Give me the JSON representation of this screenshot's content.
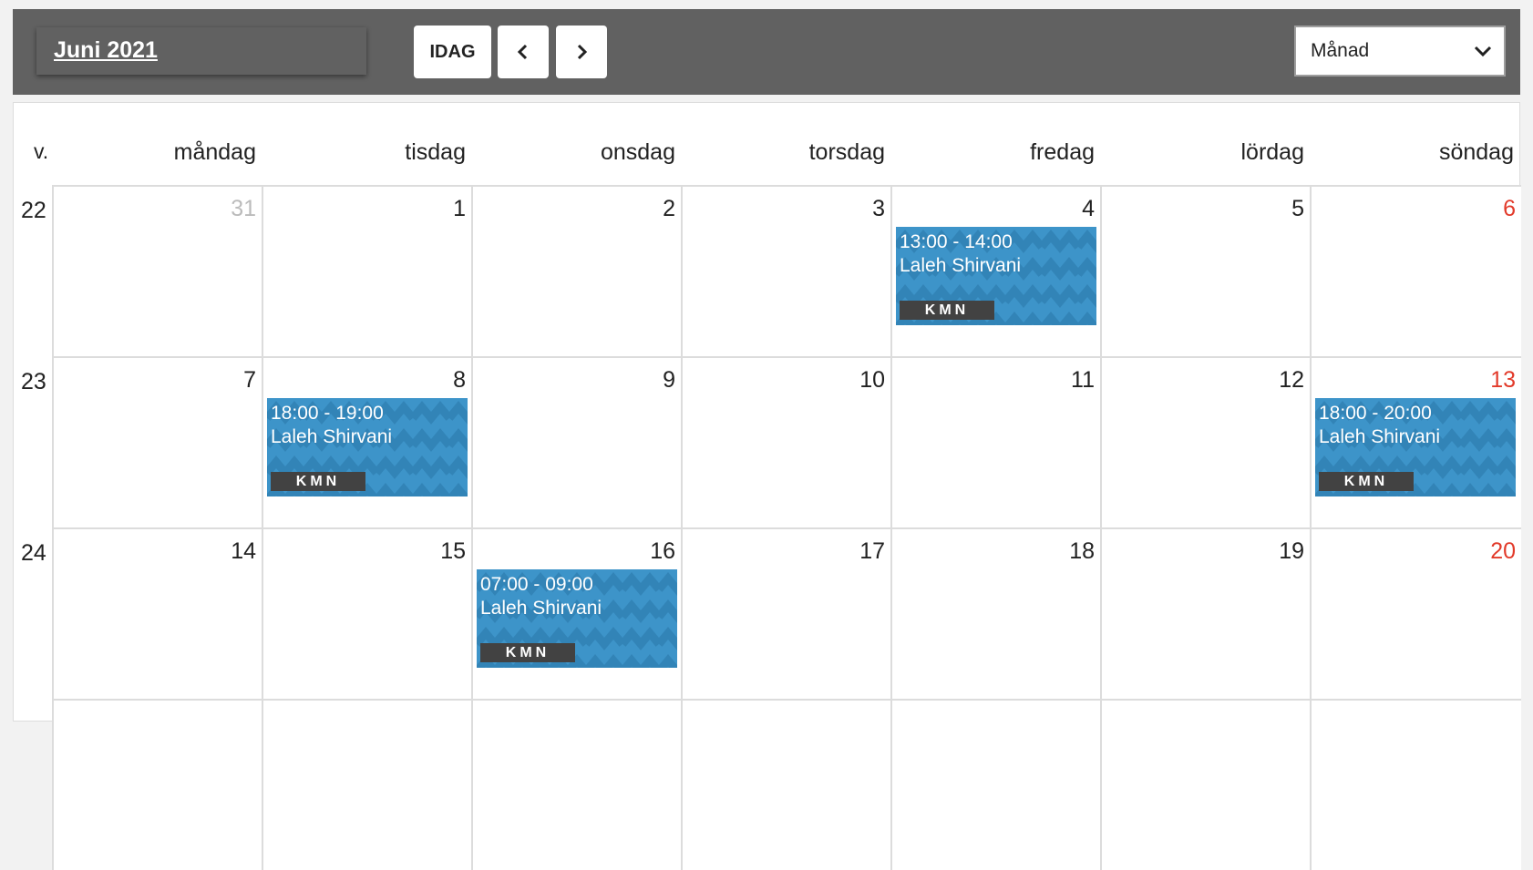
{
  "header": {
    "title": "Juni 2021",
    "today_label": "IDAG",
    "view_select": "Månad"
  },
  "calendar": {
    "week_label": "v.",
    "weekdays": [
      "måndag",
      "tisdag",
      "onsdag",
      "torsdag",
      "fredag",
      "lördag",
      "söndag"
    ],
    "weeks": [
      {
        "number": "22",
        "days": [
          {
            "day": "31",
            "other_month": true
          },
          {
            "day": "1"
          },
          {
            "day": "2"
          },
          {
            "day": "3"
          },
          {
            "day": "4",
            "event": {
              "time": "13:00 - 14:00",
              "name": "Laleh Shirvani",
              "tag": "KMN"
            }
          },
          {
            "day": "5"
          },
          {
            "day": "6",
            "sunday": true
          }
        ]
      },
      {
        "number": "23",
        "days": [
          {
            "day": "7"
          },
          {
            "day": "8",
            "event": {
              "time": "18:00 - 19:00",
              "name": "Laleh Shirvani",
              "tag": "KMN"
            }
          },
          {
            "day": "9"
          },
          {
            "day": "10"
          },
          {
            "day": "11"
          },
          {
            "day": "12"
          },
          {
            "day": "13",
            "sunday": true,
            "event": {
              "time": "18:00 - 20:00",
              "name": "Laleh Shirvani",
              "tag": "KMN"
            }
          }
        ]
      },
      {
        "number": "24",
        "days": [
          {
            "day": "14"
          },
          {
            "day": "15"
          },
          {
            "day": "16",
            "event": {
              "time": "07:00 - 09:00",
              "name": "Laleh Shirvani",
              "tag": "KMN"
            }
          },
          {
            "day": "17"
          },
          {
            "day": "18"
          },
          {
            "day": "19"
          },
          {
            "day": "20",
            "sunday": true
          }
        ]
      }
    ]
  },
  "icons": {
    "prev": "chevron-left-icon",
    "next": "chevron-right-icon",
    "dropdown": "chevron-down-icon"
  },
  "colors": {
    "toolbar": "#616161",
    "event": "#3d94c9",
    "sunday": "#e23a2a",
    "other_month": "#bbbbbb"
  }
}
